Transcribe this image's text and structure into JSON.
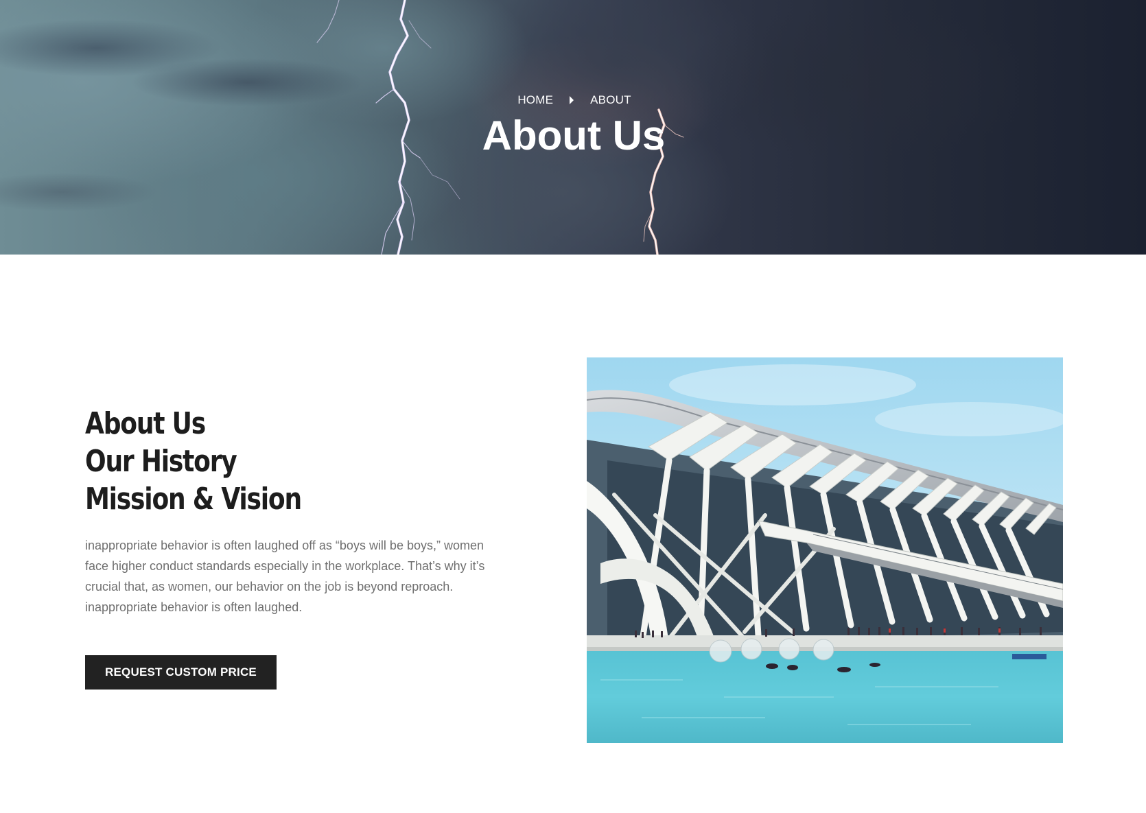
{
  "hero": {
    "breadcrumb": {
      "home": "HOME",
      "current": "ABOUT"
    },
    "title": "About Us"
  },
  "about": {
    "heading_lines": [
      "About Us",
      "Our History",
      "Mission & Vision"
    ],
    "body": "inappropriate behavior is often laughed off as “boys will be boys,” women face higher conduct standards especially in the workplace. That’s why it’s crucial that, as women, our behavior on the job is beyond reproach. inappropriate behavior is often laughed.",
    "cta_label": "REQUEST CUSTOM PRICE"
  },
  "colors": {
    "button_bg": "#222222",
    "heading": "#1d1d1d",
    "body_text": "#6f6f6f",
    "water": "#5cc9d8",
    "sky": "#a9dbef"
  }
}
